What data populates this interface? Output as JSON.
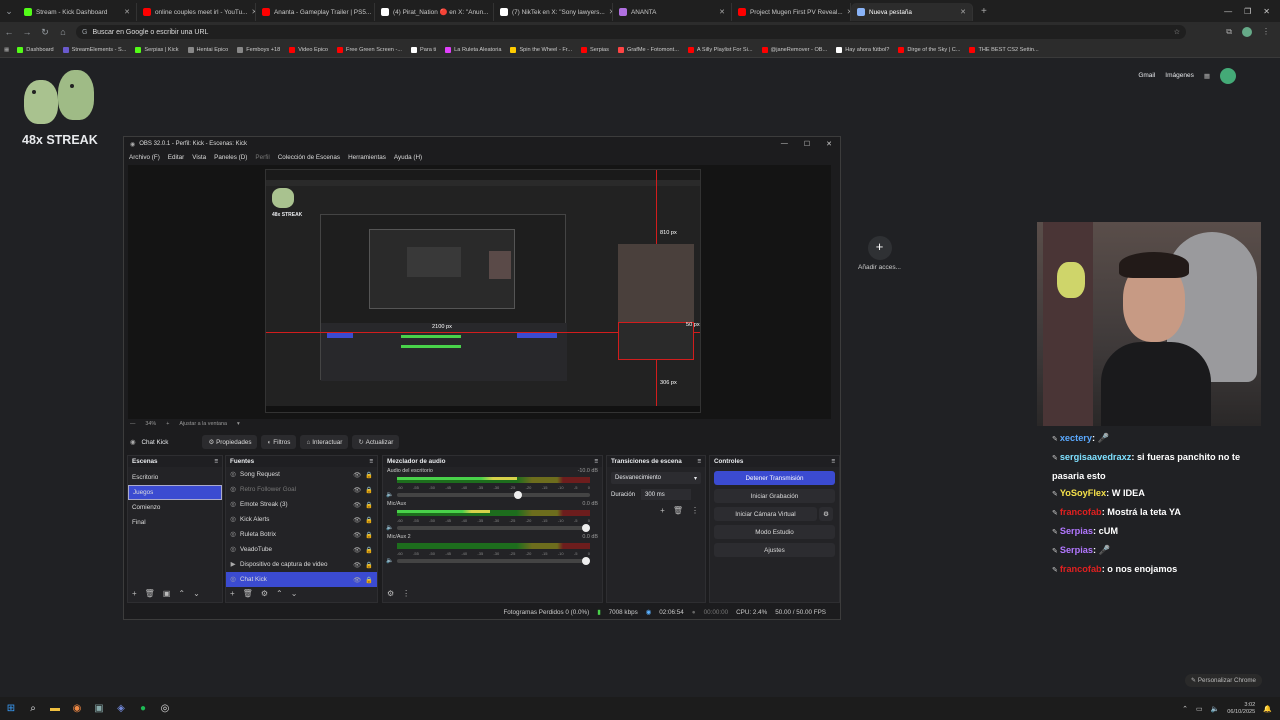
{
  "browser": {
    "tabs": [
      {
        "title": "Stream - Kick Dashboard",
        "color": "#53fc18"
      },
      {
        "title": "online couples meet irl - YouTu...",
        "color": "#ff0000"
      },
      {
        "title": "Ananta - Gameplay Trailer | PS5...",
        "color": "#ff0000"
      },
      {
        "title": "(4) Pirat_Nation 🔴 en X: \"Anun...",
        "color": "#ffffff"
      },
      {
        "title": "(7) NikTek en X: \"Sony lawyers...",
        "color": "#ffffff"
      },
      {
        "title": "ANANTA",
        "color": "#b070e0"
      },
      {
        "title": "Project Mugen First PV Reveal...",
        "color": "#ff0000"
      },
      {
        "title": "Nueva pestaña",
        "color": "#8ab4f8"
      }
    ],
    "active_tab": 7,
    "omnibox": "Buscar en Google o escribir una URL",
    "bookmarks": [
      {
        "label": "Dashboard",
        "color": "#53fc18"
      },
      {
        "label": "StreamElements - S...",
        "color": "#6a5acd"
      },
      {
        "label": "Serpias | Kick",
        "color": "#53fc18"
      },
      {
        "label": "Hentai Epico",
        "color": "#888"
      },
      {
        "label": "Femboys +18",
        "color": "#888"
      },
      {
        "label": "Video Epico",
        "color": "#ff0000"
      },
      {
        "label": "Free Green Screen -...",
        "color": "#ff0000"
      },
      {
        "label": "Para ti",
        "color": "#ffffff"
      },
      {
        "label": "La Ruleta Aleatoria",
        "color": "#e040fb"
      },
      {
        "label": "Spin the Wheel - Fr...",
        "color": "#ffcc00"
      },
      {
        "label": "Serpias",
        "color": "#ff0000"
      },
      {
        "label": "GrafMe - Fotomont...",
        "color": "#ff4444"
      },
      {
        "label": "A Silly Playlist For Si...",
        "color": "#ff0000"
      },
      {
        "label": "@janeRemover - OB...",
        "color": "#ff0000"
      },
      {
        "label": "Hay ahora fútbol?",
        "color": "#ffffff"
      },
      {
        "label": "Dirge of the Sky | C...",
        "color": "#ff0000"
      },
      {
        "label": "THE BEST CS2 Settin...",
        "color": "#ff0000"
      }
    ]
  },
  "page": {
    "streak": "48x STREAK",
    "gmail": "Gmail",
    "images": "Imágenes",
    "add_shortcut": "Añadir acces...",
    "customize": "Personalizar Chrome"
  },
  "obs": {
    "title": "OBS 32.0.1 - Perfil: Kick - Escenas: Kick",
    "menu": [
      "Archivo (F)",
      "Editar",
      "Vista",
      "Paneles (D)",
      "Perfil",
      "Colección de Escenas",
      "Herramientas",
      "Ayuda (H)"
    ],
    "zoom": "34%",
    "zoom_mode": "Ajustar a la ventana",
    "preview_labels": {
      "top": "810 px",
      "right": "50 px",
      "bottom": "306 px",
      "left": "2100 px",
      "inner_streak": "48x STREAK"
    },
    "selected_source": "Chat Kick",
    "prop_buttons": [
      "Propiedades",
      "Filtros",
      "Interactuar",
      "Actualizar"
    ],
    "docks": {
      "scenes": "Escenas",
      "sources": "Fuentes",
      "mixer": "Mezclador de audio",
      "transitions": "Transiciones de escena",
      "controls": "Controles"
    },
    "scenes": [
      "Escritorio",
      "Juegos",
      "Comienzo",
      "Final"
    ],
    "selected_scene": 1,
    "sources": [
      "Song Request",
      "Retro Follower Goal",
      "Emote Streak (3)",
      "Kick Alerts",
      "Ruleta Botrix",
      "VeadoTube",
      "Dispositivo de captura de video",
      "Chat Kick"
    ],
    "mixer": [
      {
        "name": "Audio del escritorio",
        "db": "-10.0 dB",
        "level": 0.62
      },
      {
        "name": "Mic/Aux",
        "db": "0.0 dB",
        "level": 0.48
      },
      {
        "name": "Mic/Aux 2",
        "db": "0.0 dB",
        "level": 0.0
      }
    ],
    "mixer_scale": [
      "-60",
      "-55",
      "-50",
      "-45",
      "-40",
      "-35",
      "-30",
      "-25",
      "-20",
      "-15",
      "-10",
      "-5",
      "0"
    ],
    "transition": "Desvanecimiento",
    "duration_label": "Duración",
    "duration": "300 ms",
    "controls": [
      "Detener Transmisión",
      "Iniciar Grabación",
      "Iniciar Cámara Virtual",
      "Modo Estudio",
      "Ajustes"
    ],
    "status": {
      "dropped": "Fotogramas Perdidos 0 (0.0%)",
      "bitrate": "7008 kbps",
      "live": "02:06:54",
      "rec": "00:00:00",
      "cpu": "CPU: 2.4%",
      "fps": "50.00 / 50.00 FPS"
    }
  },
  "chat": [
    {
      "user": "xectery",
      "color": "#5aa9ff",
      "text": ": 🎤"
    },
    {
      "user": "sergisaavedraxz",
      "color": "#7ee0ff",
      "text": ": si fueras panchito no te pasaria esto"
    },
    {
      "user": "YoSoyFlex",
      "color": "#f5e14a",
      "text": ": W IDEA"
    },
    {
      "user": "francofab",
      "color": "#e02020",
      "text": ": Mostrá la teta YA"
    },
    {
      "user": "Serpias",
      "color": "#b277ff",
      "text": ": cUM"
    },
    {
      "user": "Serpias",
      "color": "#b277ff",
      "text": ": 🎤"
    },
    {
      "user": "francofab",
      "color": "#e02020",
      "text": ": o nos enojamos"
    }
  ],
  "taskbar": {
    "time": "3:02",
    "date": "06/10/2025"
  }
}
